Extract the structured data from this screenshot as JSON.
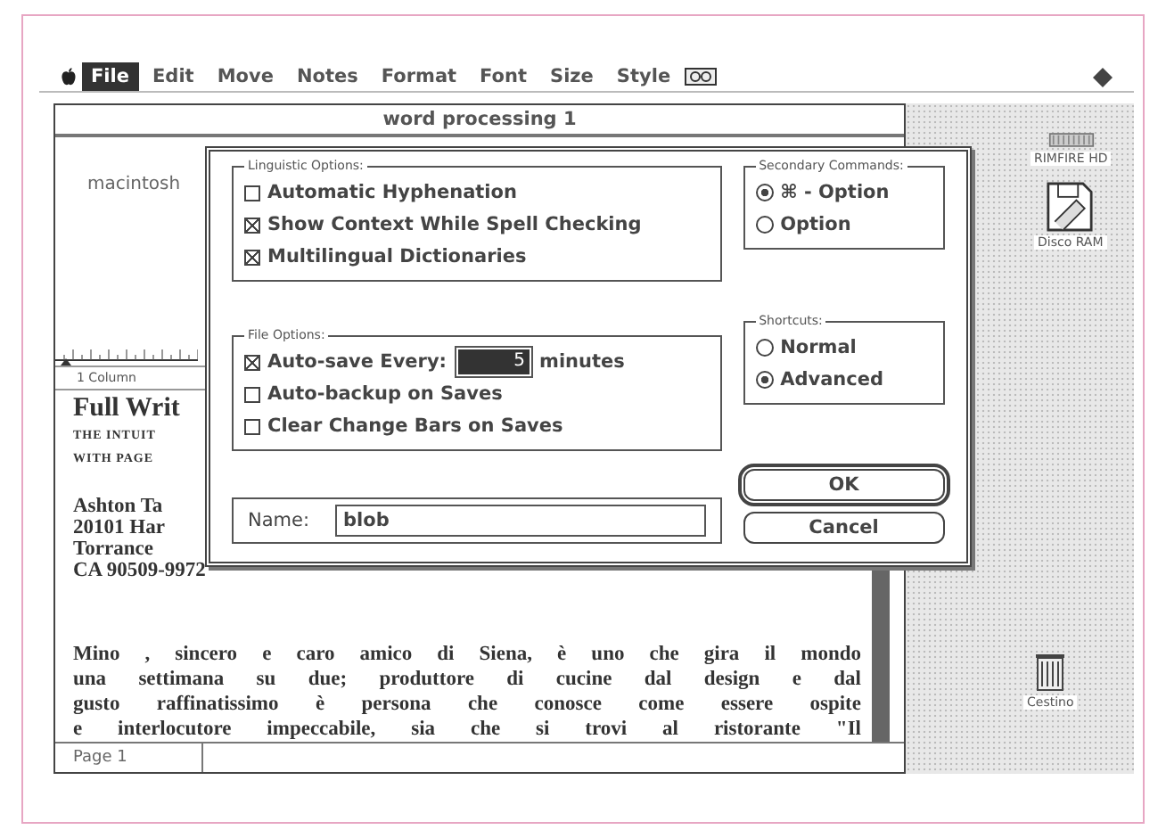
{
  "menu_bar": {
    "items": [
      {
        "label": "File",
        "selected": true
      },
      {
        "label": "Edit",
        "selected": false
      },
      {
        "label": "Move",
        "selected": false
      },
      {
        "label": "Notes",
        "selected": false
      },
      {
        "label": "Format",
        "selected": false
      },
      {
        "label": "Font",
        "selected": false
      },
      {
        "label": "Size",
        "selected": false
      },
      {
        "label": "Style",
        "selected": false
      }
    ]
  },
  "document": {
    "title": "word processing 1",
    "header_text": "macintosh",
    "column_label": "1 Column",
    "heading_lines": [
      {
        "text": "Full Writ",
        "kind": "title"
      },
      {
        "text": "THE INTUIT",
        "kind": "caps"
      },
      {
        "text": "WITH PAGE",
        "kind": "caps"
      }
    ],
    "address_lines": [
      "Ashton Ta",
      "20101 Har",
      "Torrance",
      "CA 90509-9972"
    ],
    "paragraph_lines": [
      "Mino , sincero e caro amico di Siena, è uno che gira il mondo",
      "una settimana su due; produttore di cucine dal design e dal",
      "gusto raffinatissimo è persona che conosce come essere ospite",
      "e interlocutore impeccabile, sia che si trovi al ristorante \"Il"
    ],
    "status": "Page 1"
  },
  "dialog": {
    "linguistic_options": {
      "label": "Linguistic Options:",
      "options": [
        {
          "label": "Automatic Hyphenation",
          "checked": false
        },
        {
          "label": "Show Context While Spell Checking",
          "checked": true
        },
        {
          "label": "Multilingual Dictionaries",
          "checked": true
        }
      ]
    },
    "file_options": {
      "label": "File Options:",
      "auto_save": {
        "label": "Auto-save Every:",
        "checked": true,
        "value": "5",
        "unit": "minutes"
      },
      "options": [
        {
          "label": "Auto-backup on Saves",
          "checked": false
        },
        {
          "label": "Clear Change Bars on Saves",
          "checked": false
        }
      ]
    },
    "name_field": {
      "label": "Name:",
      "value": "blob"
    },
    "secondary_commands": {
      "label": "Secondary Commands:",
      "options": [
        {
          "label": "⌘ - Option",
          "selected": true
        },
        {
          "label": "Option",
          "selected": false
        }
      ]
    },
    "shortcuts": {
      "label": "Shortcuts:",
      "options": [
        {
          "label": "Normal",
          "selected": false
        },
        {
          "label": "Advanced",
          "selected": true
        }
      ]
    },
    "buttons": [
      {
        "label": "OK",
        "default": true
      },
      {
        "label": "Cancel",
        "default": false
      }
    ]
  },
  "desktop": {
    "icons": [
      {
        "label": "RIMFIRE HD",
        "kind": "disk"
      },
      {
        "label": "Disco RAM",
        "kind": "ramdisk"
      },
      {
        "label": "Cestino",
        "kind": "trash"
      }
    ]
  }
}
